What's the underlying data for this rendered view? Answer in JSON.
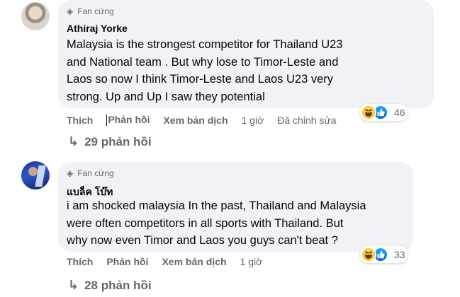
{
  "comments": [
    {
      "badge": "Fan cứng",
      "author": "Athiraj Yorke",
      "lines": [
        "Malaysia is the strongest competitor for Thailand U23",
        "and National team . But why lose to Timor-Leste and",
        "Laos so now I think Timor-Leste and Laos U23 very",
        "strong. Up and Up I saw they potential"
      ],
      "actions": {
        "like": "Thích",
        "reply": "Phản hồi",
        "translate": "Xem bản dịch",
        "time": "1 giờ",
        "edited": "Đã chỉnh sửa"
      },
      "reactions": {
        "icons": [
          "haha-icon",
          "like-icon"
        ],
        "count": "46"
      },
      "replies": "29 phản hồi"
    },
    {
      "badge": "Fan cứng",
      "author": "แบล็ค โบ๊ท",
      "lines": [
        "i am shocked malaysia In the past, Thailand and Malaysia",
        "were often competitors in all sports with Thailand. But",
        "why now even Timor and Laos you guys can't beat ?"
      ],
      "actions": {
        "like": "Thích",
        "reply": "Phản hồi",
        "translate": "Xem bản dịch",
        "time": "1 giờ"
      },
      "reactions": {
        "icons": [
          "haha-icon",
          "like-icon"
        ],
        "count": "33"
      },
      "replies": "28 phản hồi"
    }
  ],
  "colors": {
    "bubble": "#f0f2f5",
    "secondary_text": "#65676b",
    "like_blue": "#0866ff",
    "haha_yellow": "#f7b125"
  }
}
